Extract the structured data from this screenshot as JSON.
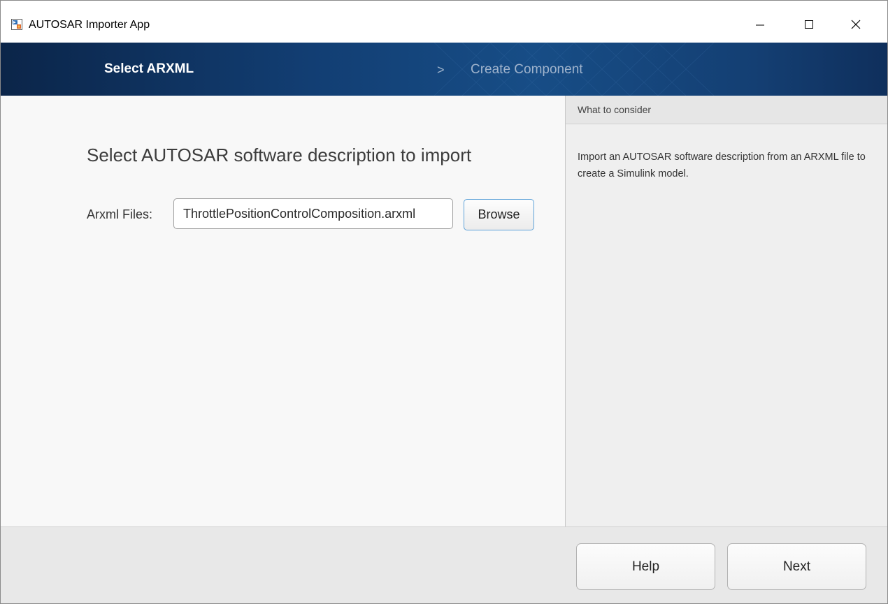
{
  "window": {
    "title": "AUTOSAR Importer App"
  },
  "steps": {
    "active": "Select ARXML",
    "separator": ">",
    "next": "Create Component"
  },
  "main": {
    "heading": "Select AUTOSAR software description to import",
    "file_label": "Arxml Files:",
    "file_value": "ThrottlePositionControlComposition.arxml",
    "browse_label": "Browse"
  },
  "side_panel": {
    "header": "What to consider",
    "body": "Import an AUTOSAR software description from an ARXML file to create a Simulink model."
  },
  "footer": {
    "help_label": "Help",
    "next_label": "Next"
  },
  "colors": {
    "banner_dark": "#0b2549",
    "banner_mid": "#174d86",
    "active_step": "#ffffff",
    "inactive_step": "#9fb3cc",
    "browse_border": "#5fa3d9"
  },
  "icons": {
    "app": "simulink-app-icon",
    "minimize": "minimize-icon",
    "maximize": "maximize-icon",
    "close": "close-icon"
  }
}
